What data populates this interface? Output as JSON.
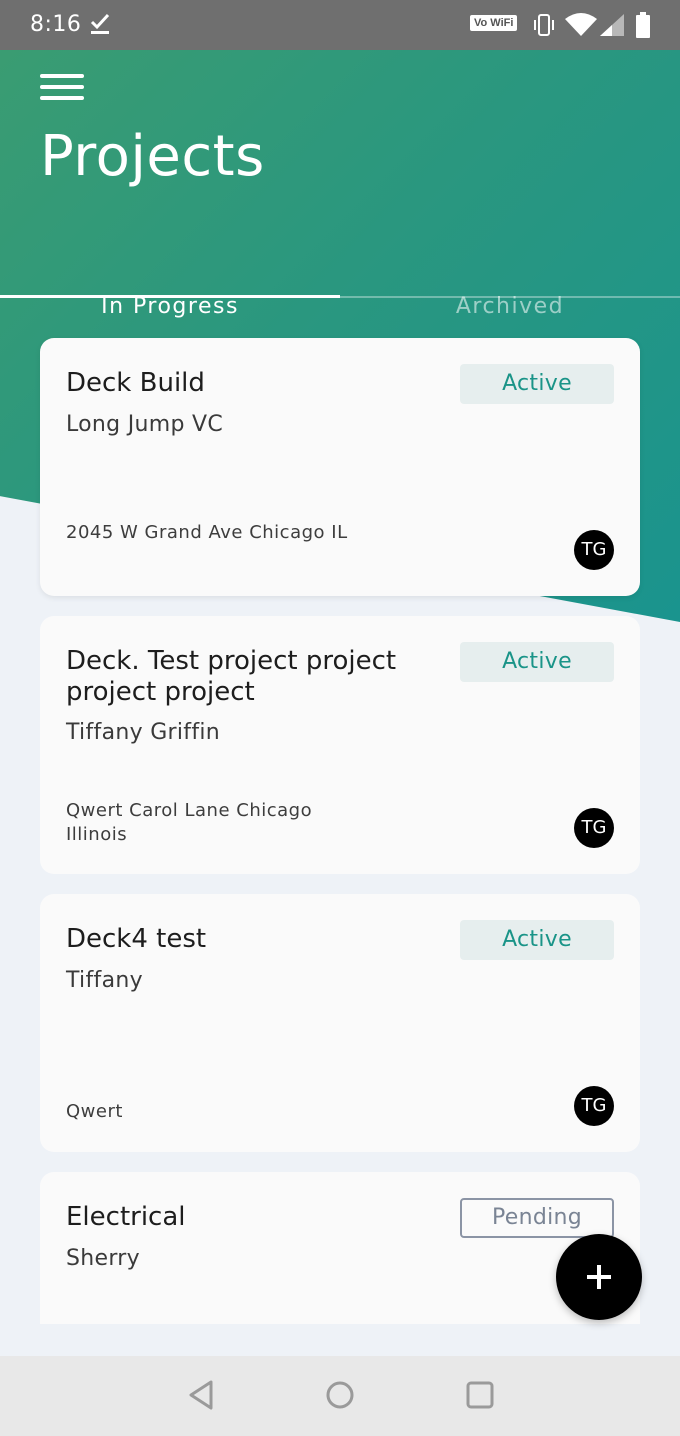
{
  "status_bar": {
    "time": "8:16",
    "vowifi": "Vo WiFi",
    "icons": [
      "check-icon",
      "vowifi-icon",
      "vibrate-icon",
      "wifi-icon",
      "signal-icon",
      "battery-icon"
    ]
  },
  "header": {
    "title": "Projects",
    "menu_icon": "hamburger-menu-icon",
    "gradient_colors": [
      "#3a9c72",
      "#1a948e"
    ]
  },
  "tabs": [
    {
      "label": "In Progress",
      "selected": true
    },
    {
      "label": "Archived",
      "selected": false
    }
  ],
  "projects": [
    {
      "title": "Deck Build",
      "client": "Long Jump VC",
      "status": "Active",
      "address": "2045 W Grand Ave Chicago IL",
      "assignee_initials": "TG"
    },
    {
      "title": "Deck. Test project project project project",
      "client": "Tiffany Griffin",
      "status": "Active",
      "address": "Qwert Carol Lane Chicago Illinois",
      "assignee_initials": "TG"
    },
    {
      "title": "Deck4 test",
      "client": "Tiffany",
      "status": "Active",
      "address": "Qwert",
      "assignee_initials": "TG"
    },
    {
      "title": "Electrical",
      "client": "Sherry",
      "status": "Pending"
    }
  ],
  "fab": {
    "icon": "plus-icon"
  },
  "nav_bar": {
    "icons": [
      "back-icon",
      "home-icon",
      "recents-icon"
    ]
  },
  "colors": {
    "accent": "#1a9488",
    "active_badge_bg": "#e6eeee",
    "pending_border": "#8b94a5",
    "avatar": "#000000"
  }
}
